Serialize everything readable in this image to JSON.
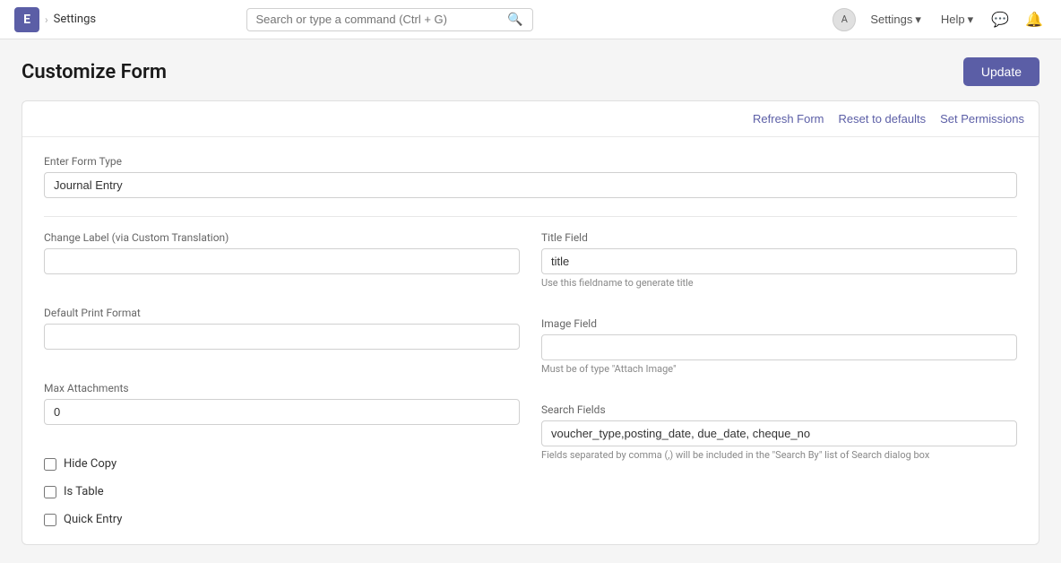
{
  "nav": {
    "app_letter": "E",
    "breadcrumb_separator": "›",
    "breadcrumb_label": "Settings",
    "search_placeholder": "Search or type a command (Ctrl + G)",
    "settings_label": "Settings",
    "help_label": "Help",
    "avatar_label": "A"
  },
  "page": {
    "title": "Customize Form",
    "update_button": "Update"
  },
  "toolbar": {
    "refresh_label": "Refresh Form",
    "reset_label": "Reset to defaults",
    "permissions_label": "Set Permissions"
  },
  "form": {
    "form_type_label": "Enter Form Type",
    "form_type_value": "Journal Entry",
    "change_label_label": "Change Label (via Custom Translation)",
    "change_label_value": "",
    "change_label_placeholder": "",
    "default_print_label": "Default Print Format",
    "default_print_value": "",
    "default_print_placeholder": "",
    "max_attachments_label": "Max Attachments",
    "max_attachments_value": "0",
    "title_field_label": "Title Field",
    "title_field_value": "title",
    "title_field_hint": "Use this fieldname to generate title",
    "image_field_label": "Image Field",
    "image_field_value": "",
    "image_field_placeholder": "",
    "image_field_hint": "Must be of type \"Attach Image\"",
    "search_fields_label": "Search Fields",
    "search_fields_value": "voucher_type,posting_date, due_date, cheque_no",
    "search_fields_hint": "Fields separated by comma (,) will be included in the \"Search By\" list of Search dialog box",
    "hide_copy_label": "Hide Copy",
    "hide_copy_checked": false,
    "is_table_label": "Is Table",
    "is_table_checked": false,
    "quick_entry_label": "Quick Entry",
    "quick_entry_checked": false
  }
}
